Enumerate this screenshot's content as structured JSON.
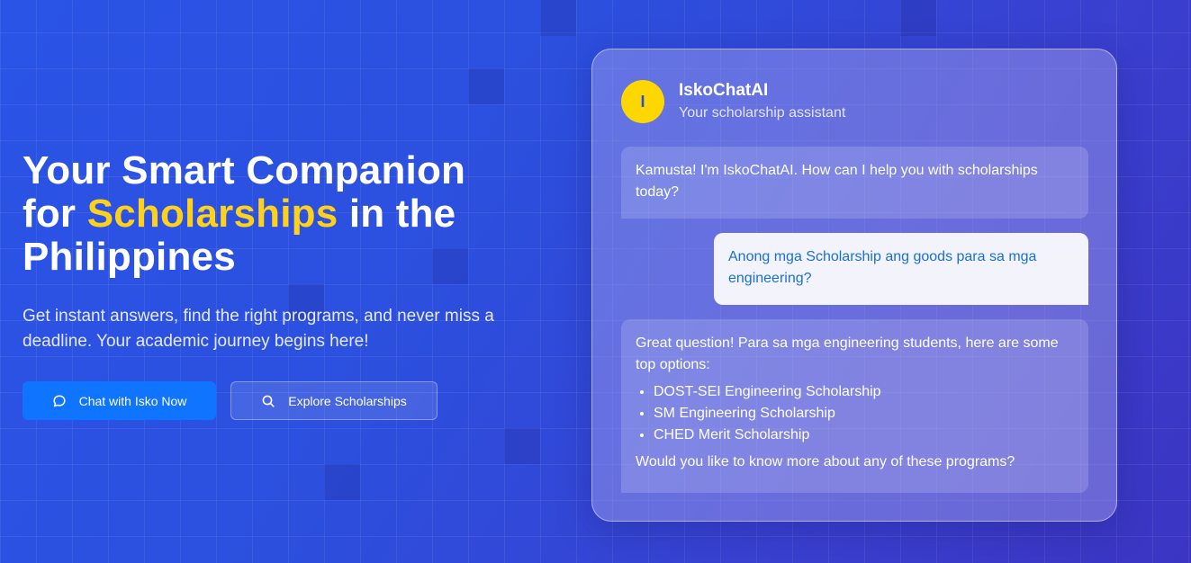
{
  "hero": {
    "title_line1": "Your Smart Companion",
    "title_for": "for ",
    "title_highlight": "Scholarships",
    "title_rest": " in the",
    "title_line3": "Philippines",
    "subtitle": "Get instant answers, find the right programs, and never miss a deadline. Your academic journey begins here!",
    "primary_button": {
      "label": "Chat with Isko Now",
      "icon": "chat-bubble-icon"
    },
    "secondary_button": {
      "label": "Explore Scholarships",
      "icon": "search-icon"
    }
  },
  "chat": {
    "avatar_letter": "I",
    "bot_name": "IskoChatAI",
    "bot_subtitle": "Your scholarship assistant",
    "messages": [
      {
        "role": "bot",
        "text": "Kamusta! I'm IskoChatAI. How can I help you with scholarships today?"
      },
      {
        "role": "user",
        "text": "Anong mga Scholarship ang goods para sa mga engineering?"
      },
      {
        "role": "bot",
        "intro": "Great question! Para sa mga engineering students, here are some top options:",
        "items": [
          "DOST-SEI Engineering Scholarship",
          "SM Engineering Scholarship",
          "CHED Merit Scholarship"
        ],
        "outro": "Would you like to know more about any of these programs?"
      }
    ]
  },
  "colors": {
    "accent_yellow": "#ffd11a",
    "primary_button": "#0f74ff",
    "user_text": "#1a6fd8",
    "avatar": "#ffd700"
  }
}
